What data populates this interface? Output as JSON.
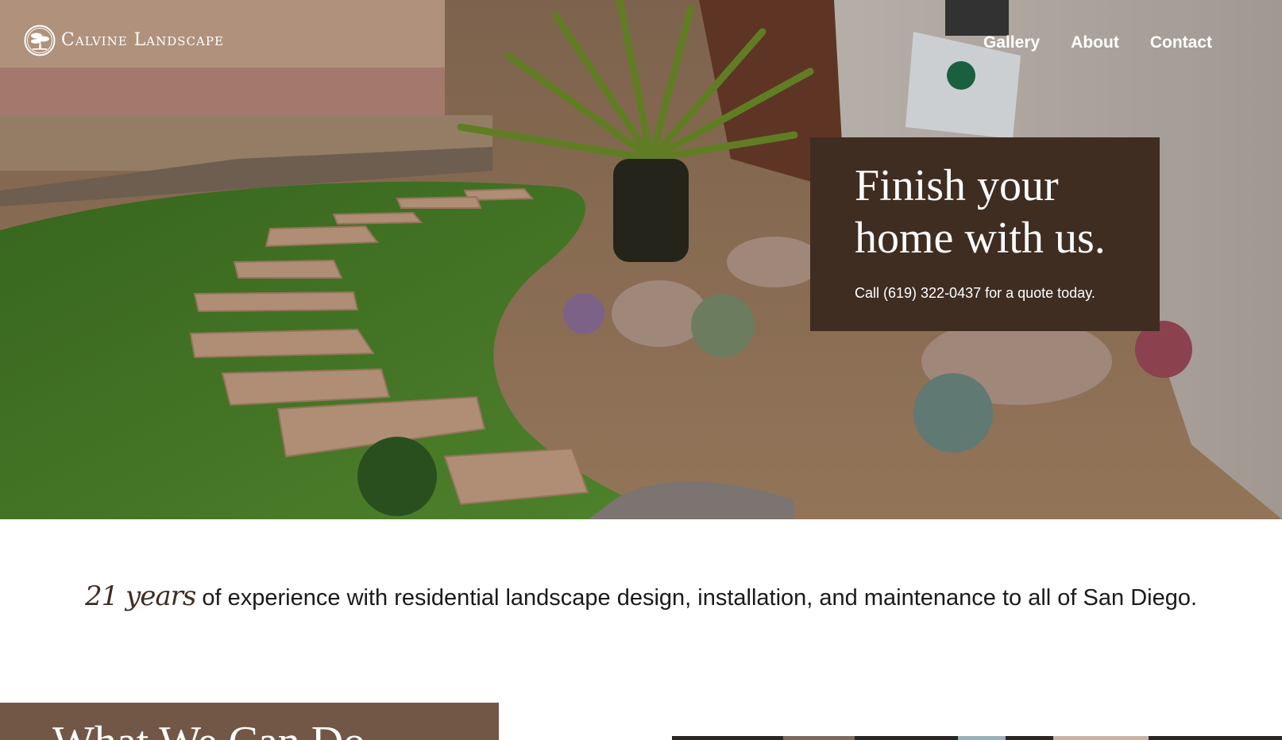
{
  "brand": {
    "name": "Calvine Landscape"
  },
  "nav": {
    "items": [
      "Gallery",
      "About",
      "Contact"
    ]
  },
  "hero": {
    "headline": "Finish your home with us.",
    "subtext": "Call (619) 322-0437 for a quote today.",
    "sign_text": "Calvine Landscape",
    "colors": {
      "overlay_box": "#3f2d22",
      "lawn": "#4f8a2e",
      "gravel": "#a88363"
    }
  },
  "experience": {
    "years": "21 years",
    "text": " of experience with residential landscape design, installation, and maintenance to all of San Diego."
  },
  "services": {
    "title": "What We Can Do",
    "colors": {
      "header_bg": "#735746"
    }
  }
}
